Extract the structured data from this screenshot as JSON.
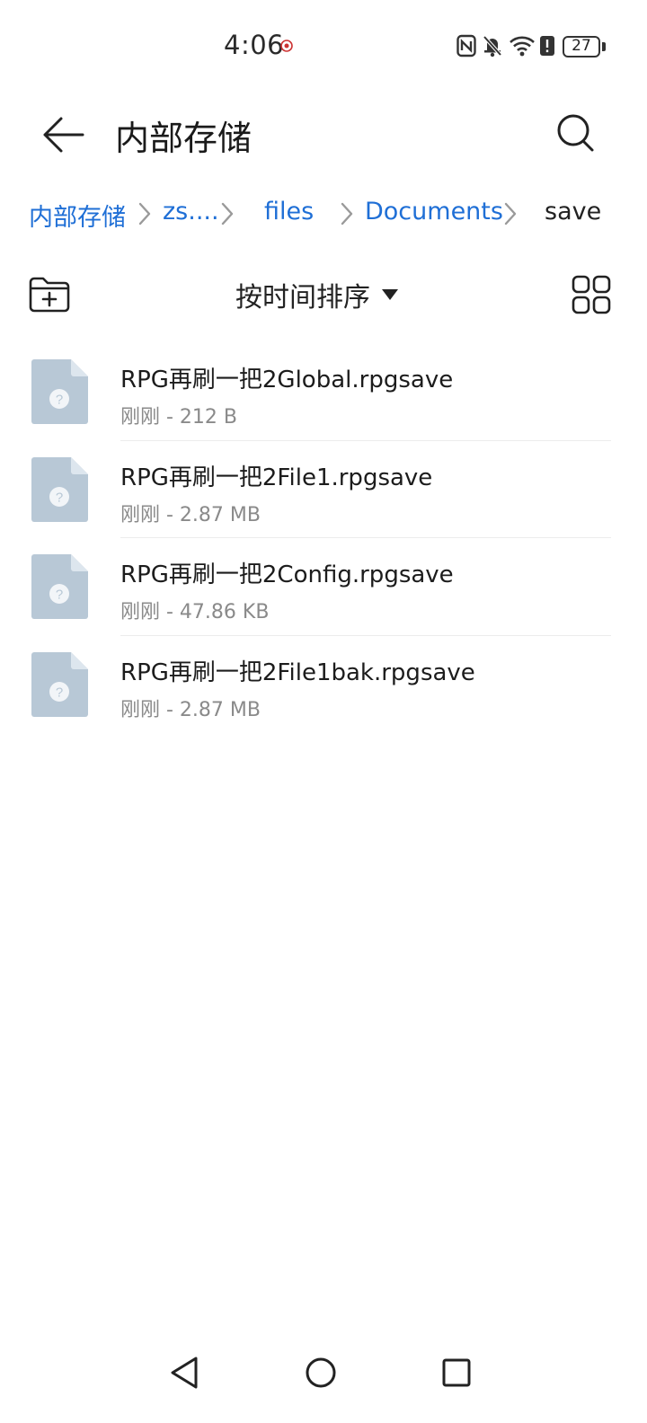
{
  "status_bar": {
    "time": "4:06",
    "battery_level": "27",
    "icons": [
      "nfc-icon",
      "bell-off-icon",
      "wifi-icon",
      "battery-alert-icon",
      "battery-icon"
    ]
  },
  "app_bar": {
    "title": "内部存储",
    "back_icon": "arrow-left-icon",
    "search_icon": "search-icon"
  },
  "breadcrumb": {
    "items": [
      "内部存储",
      "zs....",
      "files",
      "Documents",
      "save"
    ],
    "link_color": "#1f6fd6"
  },
  "toolbar": {
    "sort_label": "按时间排序",
    "new_folder_icon": "folder-add-icon",
    "grid_view_icon": "grid-view-icon"
  },
  "files": [
    {
      "name": "RPG再刷一把2Global.rpgsave",
      "meta": "刚刚 - 212 B"
    },
    {
      "name": "RPG再刷一把2File1.rpgsave",
      "meta": "刚刚 - 2.87 MB"
    },
    {
      "name": "RPG再刷一把2Config.rpgsave",
      "meta": "刚刚 - 47.86 KB"
    },
    {
      "name": "RPG再刷一把2File1bak.rpgsave",
      "meta": "刚刚 - 2.87 MB"
    }
  ],
  "file_icon": "unknown-file-icon",
  "nav_bar": {
    "icons": [
      "nav-back-icon",
      "nav-home-icon",
      "nav-recents-icon"
    ]
  }
}
